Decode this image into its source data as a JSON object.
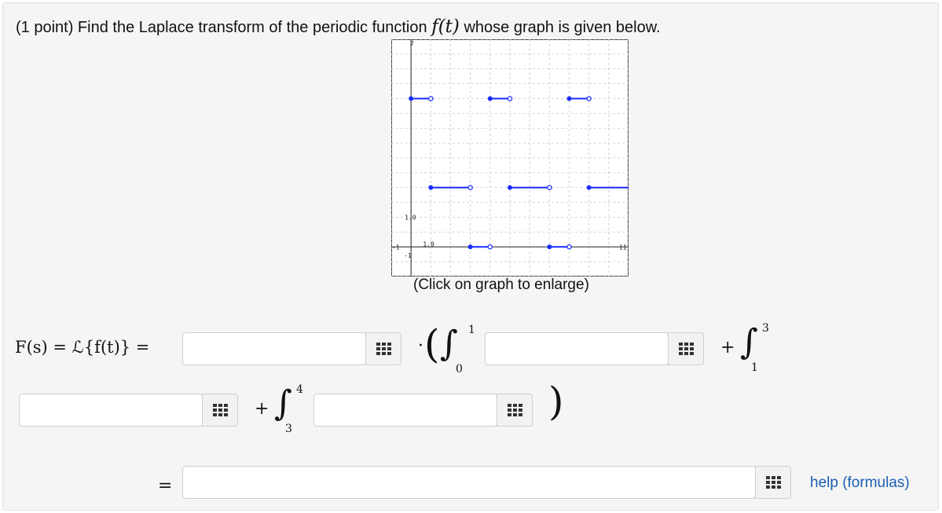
{
  "question": {
    "prefix": "(1 point) Find the Laplace transform of the periodic function ",
    "fn": "f(t)",
    "suffix": " whose graph is given below."
  },
  "graph": {
    "caption": "(Click on graph to enlarge)",
    "tick_labels": {
      "y_top": "7",
      "y_mid": "1.0",
      "x_mid": "1.0",
      "x_left": "-1",
      "x_right": "11",
      "y_bottom": "-1"
    },
    "line_color": "#1a2cff",
    "chart_data": {
      "type": "line",
      "xlim": [
        -1,
        11
      ],
      "ylim": [
        -1,
        7
      ],
      "grid": true,
      "segments": [
        {
          "x": [
            0,
            1
          ],
          "y": [
            5,
            5
          ]
        },
        {
          "x": [
            1,
            3
          ],
          "y": [
            2,
            2
          ]
        },
        {
          "x": [
            3,
            4
          ],
          "y": [
            0,
            0
          ]
        },
        {
          "x": [
            4,
            5
          ],
          "y": [
            5,
            5
          ]
        },
        {
          "x": [
            5,
            7
          ],
          "y": [
            2,
            2
          ]
        },
        {
          "x": [
            7,
            8
          ],
          "y": [
            0,
            0
          ]
        },
        {
          "x": [
            8,
            9
          ],
          "y": [
            5,
            5
          ]
        },
        {
          "x": [
            9,
            11
          ],
          "y": [
            2,
            2
          ]
        }
      ]
    }
  },
  "formula": {
    "lhs": "F(s) = ℒ{f(t)} =",
    "dot": "·",
    "open_paren": "(",
    "close_paren": ")",
    "plus": "+",
    "equals": "=",
    "int1": {
      "symbol": "∫",
      "lower": "0",
      "upper": "1"
    },
    "int2": {
      "symbol": "∫",
      "lower": "1",
      "upper": "3"
    },
    "int3": {
      "symbol": "∫",
      "lower": "3",
      "upper": "4"
    }
  },
  "inputs": {
    "a1": "",
    "a2": "",
    "a3": "",
    "a4": "",
    "a5": ""
  },
  "icons": {
    "keypad": "keypad-icon"
  },
  "help": {
    "label": "help (formulas)"
  }
}
